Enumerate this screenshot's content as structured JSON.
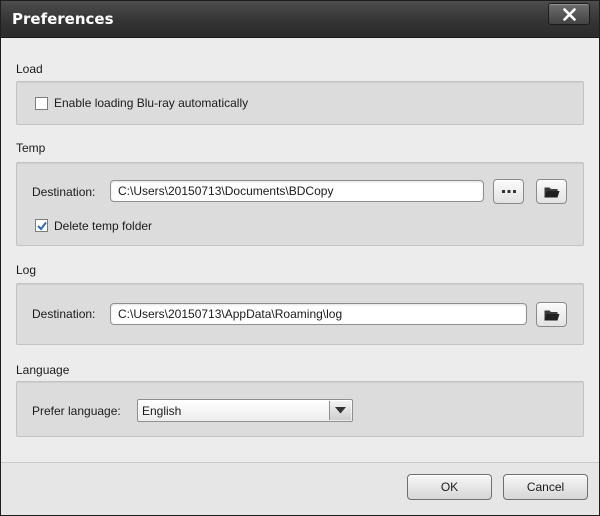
{
  "window": {
    "title": "Preferences"
  },
  "load": {
    "label": "Load",
    "enable_bluray": {
      "label": "Enable loading Blu-ray automatically",
      "checked": false
    }
  },
  "temp": {
    "label": "Temp",
    "destination_label": "Destination:",
    "destination_value": "C:\\Users\\20150713\\Documents\\BDCopy",
    "delete_temp": {
      "label": "Delete temp folder",
      "checked": true
    }
  },
  "log": {
    "label": "Log",
    "destination_label": "Destination:",
    "destination_value": "C:\\Users\\20150713\\AppData\\Roaming\\log"
  },
  "language": {
    "label": "Language",
    "prefer_label": "Prefer language:",
    "selected": "English"
  },
  "footer": {
    "ok_label": "OK",
    "cancel_label": "Cancel"
  },
  "icons": {
    "close": "close-icon",
    "browse": "ellipsis-icon",
    "open_folder": "folder-icon",
    "dropdown": "chevron-down-icon"
  },
  "colors": {
    "titlebar": "#353535",
    "panel": "#dcdcdc",
    "checkmark": "#2b6cb0"
  }
}
